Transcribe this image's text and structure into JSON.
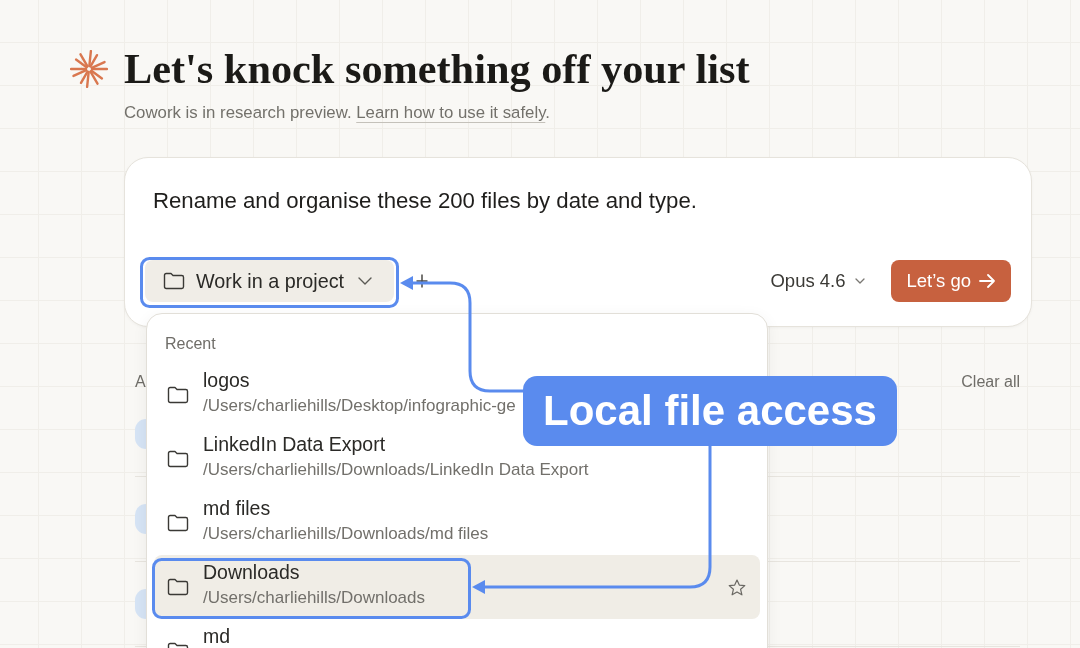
{
  "header": {
    "title": "Let's knock something off your list",
    "notice": "Cowork is in research preview.",
    "link": "Learn how to use it safely",
    "notice_end": "."
  },
  "prompt": {
    "value": "Rename and organise these 200 files by date and type."
  },
  "toolbar": {
    "project_button": "Work in a project",
    "model": "Opus 4.6",
    "submit": "Let’s go"
  },
  "project_menu": {
    "heading": "Recent",
    "items": [
      {
        "name": "logos",
        "path": "/Users/charliehills/Desktop/infographic-ge",
        "selected": false
      },
      {
        "name": "LinkedIn Data Export",
        "path": "/Users/charliehills/Downloads/LinkedIn Data Export",
        "selected": false
      },
      {
        "name": "md files",
        "path": "/Users/charliehills/Downloads/md files",
        "selected": false
      },
      {
        "name": "Downloads",
        "path": "/Users/charliehills/Downloads",
        "selected": true
      },
      {
        "name": "md",
        "selected": false
      }
    ]
  },
  "task_list": {
    "heading": "A",
    "action": "Clear all"
  },
  "callout": {
    "label": "Local file access"
  }
}
